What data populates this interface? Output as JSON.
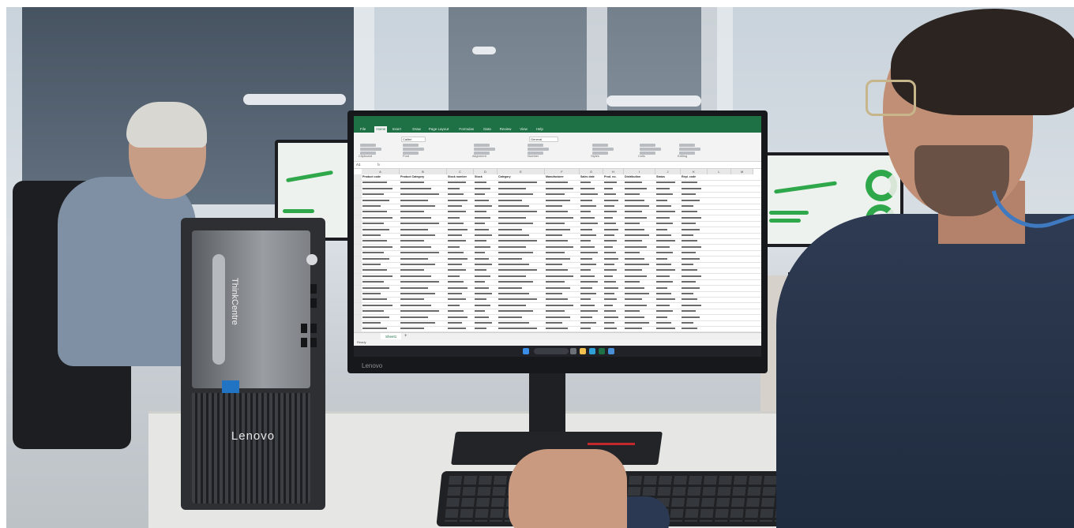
{
  "tower_pc": {
    "brand_front": "Lenovo",
    "brand_vertical": "ThinkCentre"
  },
  "monitor": {
    "brand": "Lenovo",
    "spreadsheet": {
      "menu_tabs": [
        "File",
        "Home",
        "Insert",
        "Draw",
        "Page Layout",
        "Formulas",
        "Data",
        "Review",
        "View",
        "Help"
      ],
      "active_tab": "Home",
      "ribbon_groups": [
        "Clipboard",
        "Font",
        "Alignment",
        "Number",
        "Styles",
        "Cells",
        "Editing"
      ],
      "font_name": "Calibri",
      "number_format": "General",
      "cell_ref": "A1",
      "columns": [
        "A",
        "B",
        "C",
        "D",
        "E",
        "F",
        "G",
        "H",
        "I",
        "J",
        "K",
        "L",
        "M"
      ],
      "headers": [
        "Product code",
        "Product Category",
        "Stock number",
        "Stock",
        "Category",
        "Manufacturer",
        "Sales date",
        "Prod. no.",
        "Distribution",
        "Status",
        "Repl. code"
      ],
      "sheet_tab": "Sheet1",
      "status_text": "Ready",
      "accent": "#1e7145"
    }
  },
  "colors": {
    "excel_green": "#1e7145",
    "desk": "#e6e6e4",
    "dashboard_green": "#2ea84a",
    "lenovo_red": "#c4282c",
    "intel_blue": "#2173c4"
  }
}
